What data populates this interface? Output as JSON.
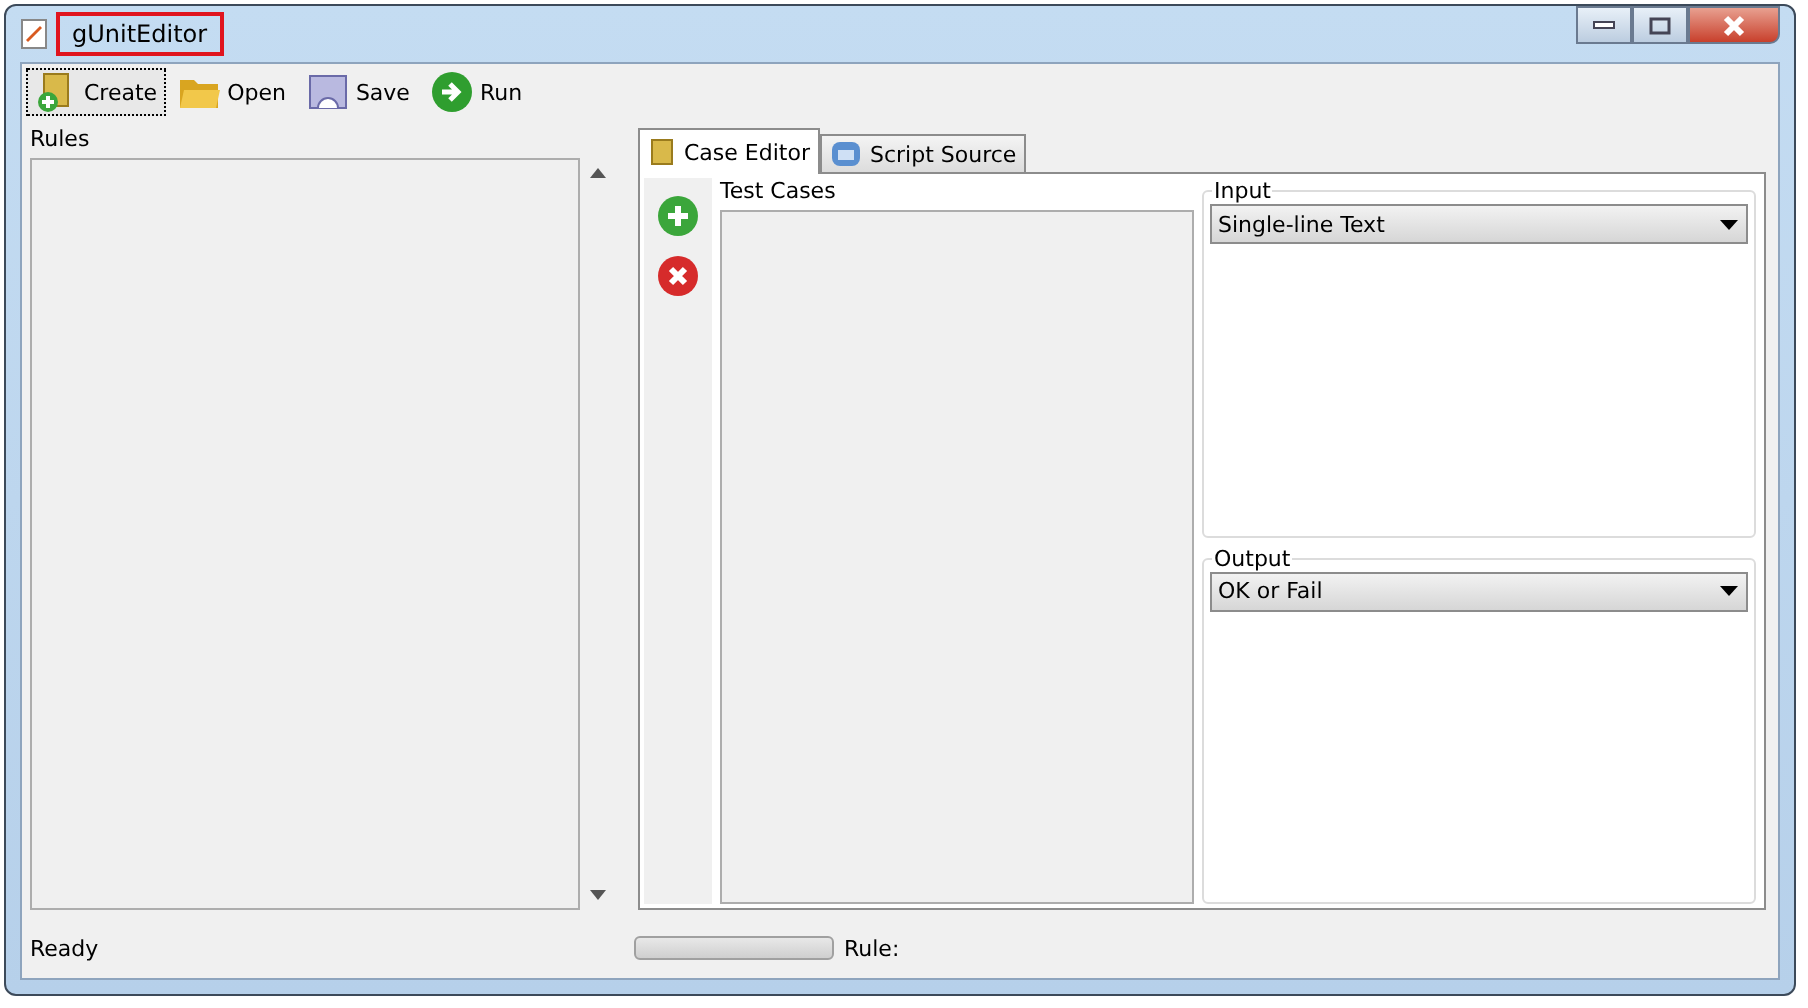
{
  "window": {
    "title": "gUnitEditor",
    "title_highlighted": true
  },
  "toolbar": [
    {
      "label": "Create",
      "kind": "create",
      "focused": true
    },
    {
      "label": "Open",
      "kind": "open",
      "focused": false
    },
    {
      "label": "Save",
      "kind": "save",
      "focused": false
    },
    {
      "label": "Run",
      "kind": "run",
      "focused": false
    }
  ],
  "rules": {
    "label": "Rules"
  },
  "tabs": [
    {
      "label": "Case Editor",
      "kind": "case",
      "selected": true
    },
    {
      "label": "Script Source",
      "kind": "script",
      "selected": false
    }
  ],
  "test_cases": {
    "label": "Test Cases"
  },
  "input": {
    "label": "Input",
    "value": "Single-line Text"
  },
  "output": {
    "label": "Output",
    "value": "OK or Fail"
  },
  "status_bar": {
    "text": "Ready",
    "progress": {
      "level": 0
    },
    "rule_label": "Rule:"
  }
}
